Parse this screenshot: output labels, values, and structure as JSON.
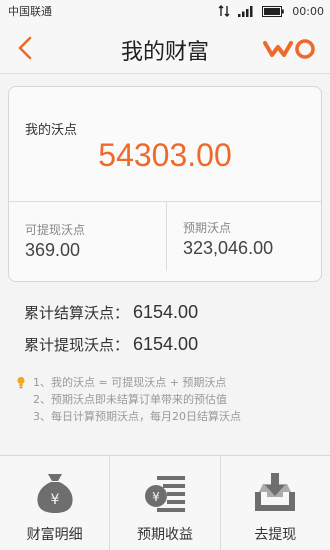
{
  "status_bar": {
    "carrier": "中国联通",
    "time": "00:00"
  },
  "nav": {
    "title": "我的财富",
    "back_icon": "chevron-left-icon",
    "logo": "wo-logo"
  },
  "card": {
    "total_label": "我的沃点",
    "total_value": "54303.00",
    "withdrawable_label": "可提现沃点",
    "withdrawable_value": "369.00",
    "expected_label": "预期沃点",
    "expected_value": "323,046.00"
  },
  "summary": {
    "settled_label": "累计结算沃点：",
    "settled_value": "6154.00",
    "withdrawn_label": "累计提现沃点：",
    "withdrawn_value": "6154.00"
  },
  "notes": [
    "1、我的沃点 = 可提现沃点 + 预期沃点",
    "2、预期沃点即未结算订单带来的预估值",
    "3、每日计算预期沃点，每月20日结算沃点"
  ],
  "bottom_nav": [
    {
      "label": "财富明细",
      "icon": "money-bag-icon"
    },
    {
      "label": "预期收益",
      "icon": "coin-receipt-icon"
    },
    {
      "label": "去提现",
      "icon": "withdraw-tray-icon"
    }
  ],
  "colors": {
    "accent": "#ef6a2a",
    "muted": "#999999"
  }
}
